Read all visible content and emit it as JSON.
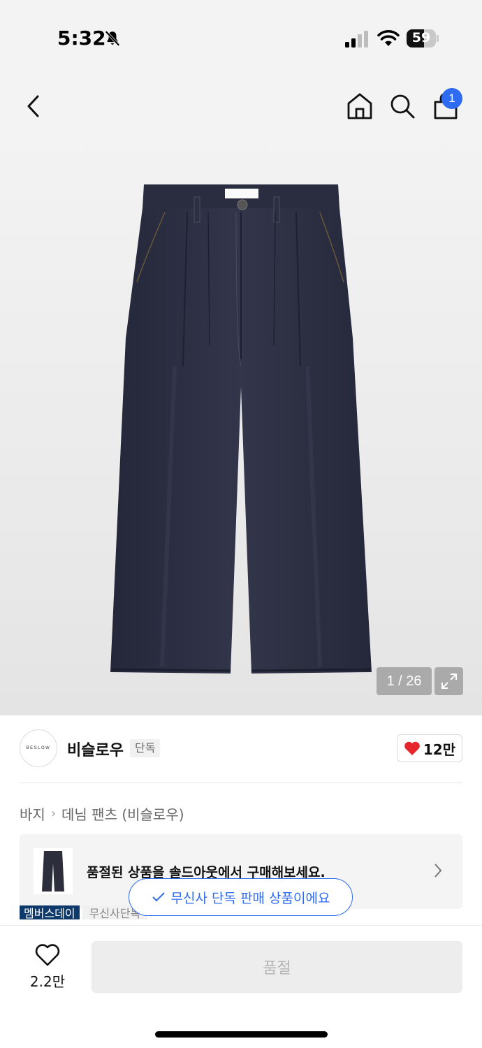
{
  "status_bar": {
    "time": "5:32",
    "battery": "59",
    "battery_level": 0.59
  },
  "nav": {
    "icons": [
      "back-icon",
      "home-icon",
      "search-icon",
      "shopping-bag-icon"
    ],
    "cart_badge": "1"
  },
  "gallery": {
    "counter": "1 / 26",
    "image_alt": "dark navy denim pleated wide pants"
  },
  "brand": {
    "logo_text": "BESLOW",
    "name": "비슬로우",
    "exclusive_tag": "단독",
    "like_count": "12만"
  },
  "breadcrumb": {
    "level1": "바지",
    "level2": "데님 팬츠 (비슬로우)"
  },
  "soldout_banner": {
    "text": "품절된 상품을 솔드아웃에서 구매해보세요."
  },
  "tags": {
    "dark": "멤버스데이",
    "light": "무신사단독"
  },
  "toast": {
    "text": "무신사 단독 판매 상품이에요"
  },
  "bottom_bar": {
    "wish_count": "2.2만",
    "buy_label": "품절"
  },
  "colors": {
    "accent": "#2f6bf1",
    "like_red": "#e5262d",
    "tag_navy": "#0e3a6b",
    "denim": "#2c2f3b"
  }
}
